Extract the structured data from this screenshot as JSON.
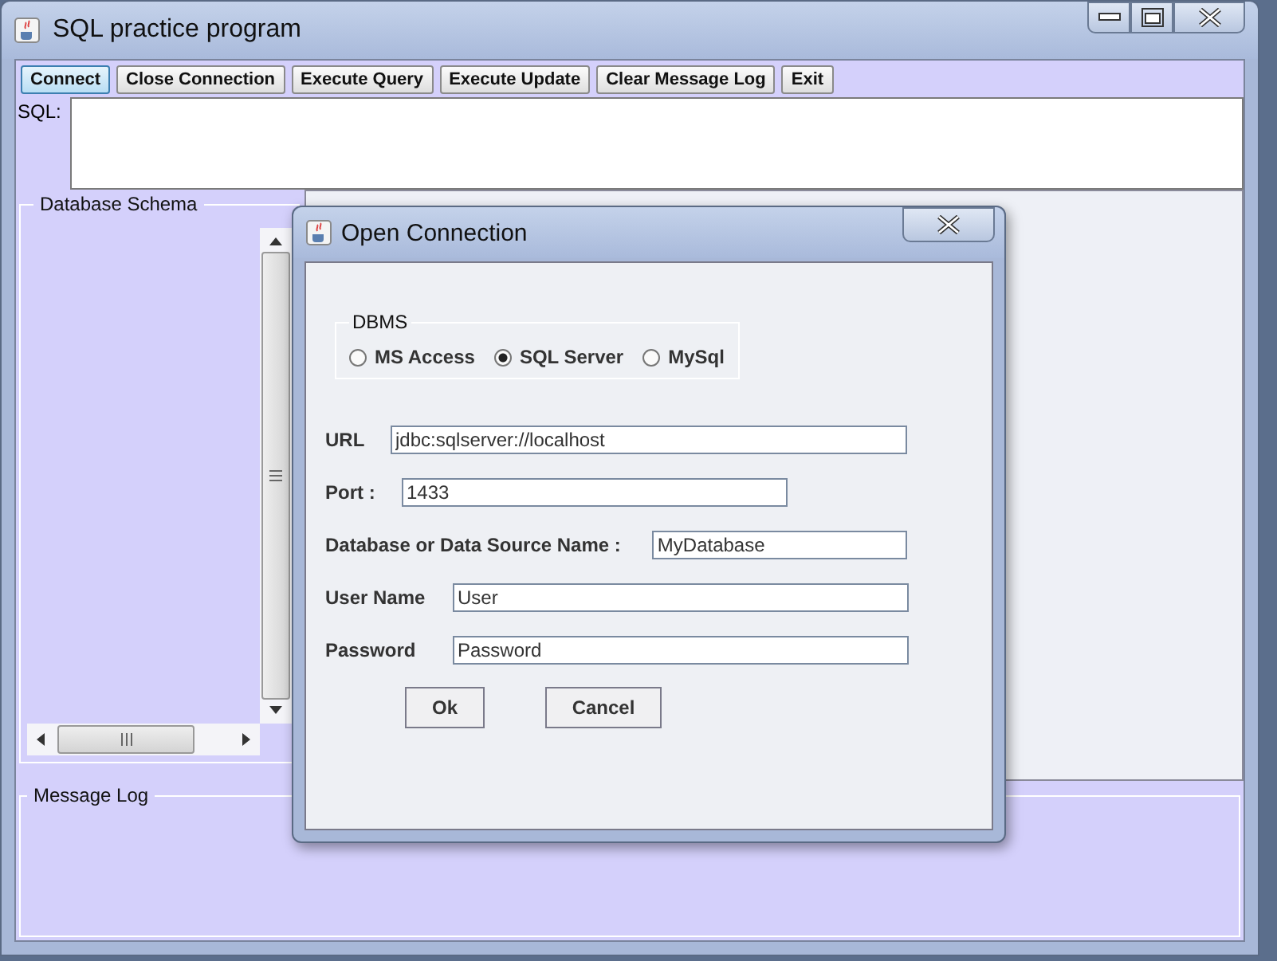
{
  "window": {
    "title": "SQL practice program"
  },
  "toolbar": [
    {
      "label": "Connect",
      "focused": true
    },
    {
      "label": "Close Connection",
      "focused": false
    },
    {
      "label": "Execute Query",
      "focused": false
    },
    {
      "label": "Execute Update",
      "focused": false
    },
    {
      "label": "Clear Message Log",
      "focused": false
    },
    {
      "label": "Exit",
      "focused": false
    }
  ],
  "sql": {
    "label": "SQL:"
  },
  "schema_panel": {
    "title": "Database Schema"
  },
  "message_log": {
    "title": "Message Log"
  },
  "dialog": {
    "title": "Open Connection",
    "dbms": {
      "title": "DBMS",
      "options": [
        {
          "label": "MS Access",
          "selected": false
        },
        {
          "label": "SQL Server",
          "selected": true
        },
        {
          "label": "MySql",
          "selected": false
        }
      ]
    },
    "fields": [
      {
        "label": "URL",
        "value": "jdbc:sqlserver://localhost"
      },
      {
        "label": "Port :",
        "value": "1433"
      },
      {
        "label": "Database or Data Source Name :",
        "value": "MyDatabase"
      },
      {
        "label": "User Name",
        "value": "User"
      },
      {
        "label": "Password",
        "value": "Password"
      }
    ],
    "buttons": [
      "Ok",
      "Cancel"
    ]
  }
}
